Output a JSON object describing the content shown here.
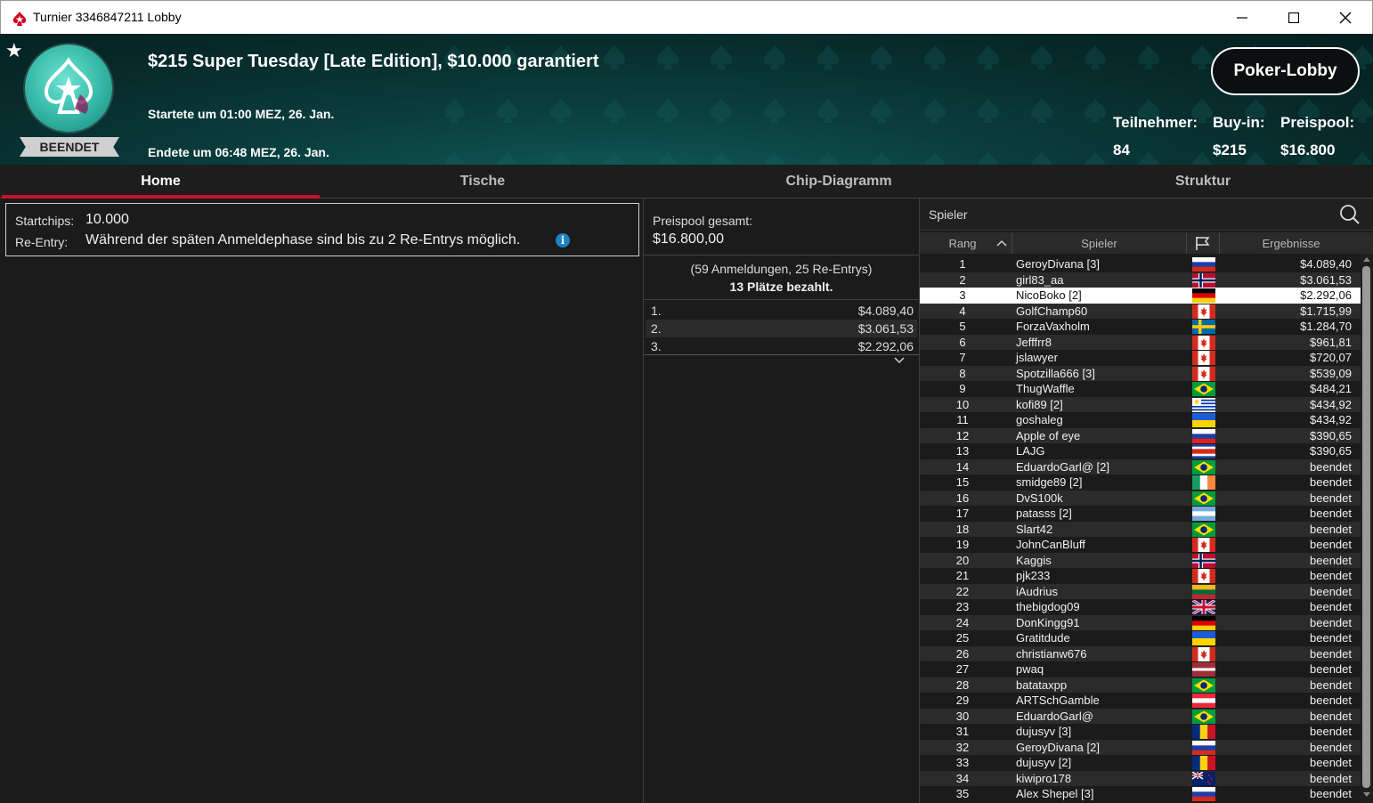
{
  "window": {
    "title": "Turnier 3346847211 Lobby"
  },
  "header": {
    "tournament_title": "$215 Super Tuesday [Late Edition], $10.000 garantiert",
    "status_badge": "BEENDET",
    "started": "Startete um 01:00 MEZ, 26. Jan.",
    "ended": "Endete um 06:48 MEZ, 26. Jan.",
    "lobby_button": "Poker-Lobby",
    "stats": {
      "participants_label": "Teilnehmer:",
      "participants": "84",
      "buyin_label": "Buy-in:",
      "buyin": "$215",
      "prizepool_label": "Preispool:",
      "prizepool": "$16.800"
    }
  },
  "tabs": [
    {
      "label": "Home",
      "active": true
    },
    {
      "label": "Tische",
      "active": false
    },
    {
      "label": "Chip-Diagramm",
      "active": false
    },
    {
      "label": "Struktur",
      "active": false
    }
  ],
  "info": {
    "startchips_label": "Startchips:",
    "startchips": "10.000",
    "reentry_label": "Re-Entry:",
    "reentry": "Während der späten Anmeldephase sind bis zu 2 Re-Entrys möglich."
  },
  "prize": {
    "total_label": "Preispool gesamt:",
    "total": "$16.800,00",
    "entries": "(59 Anmeldungen, 25 Re-Entrys)",
    "paid": "13 Plätze bezahlt.",
    "payouts": [
      {
        "rank": "1.",
        "amount": "$4.089,40"
      },
      {
        "rank": "2.",
        "amount": "$3.061,53"
      },
      {
        "rank": "3.",
        "amount": "$2.292,06"
      }
    ]
  },
  "players": {
    "search_placeholder": "Spieler",
    "col_rank": "Rang",
    "col_player": "Spieler",
    "col_result": "Ergebnisse",
    "highlight_rank": "3",
    "rows": [
      {
        "rank": "1",
        "name": "GeroyDivana [3]",
        "flag": "ru",
        "result": "$4.089,40"
      },
      {
        "rank": "2",
        "name": "girl83_aa",
        "flag": "no",
        "result": "$3.061,53"
      },
      {
        "rank": "3",
        "name": "NicoBoko [2]",
        "flag": "de",
        "result": "$2.292,06"
      },
      {
        "rank": "4",
        "name": "GolfChamp60",
        "flag": "ca",
        "result": "$1.715,99"
      },
      {
        "rank": "5",
        "name": "ForzaVaxholm",
        "flag": "se",
        "result": "$1.284,70"
      },
      {
        "rank": "6",
        "name": "Jefffrr8",
        "flag": "ca",
        "result": "$961,81"
      },
      {
        "rank": "7",
        "name": "jslawyer",
        "flag": "ca",
        "result": "$720,07"
      },
      {
        "rank": "8",
        "name": "Spotzilla666 [3]",
        "flag": "ca",
        "result": "$539,09"
      },
      {
        "rank": "9",
        "name": "ThugWaffle",
        "flag": "br",
        "result": "$484,21"
      },
      {
        "rank": "10",
        "name": "kofi89 [2]",
        "flag": "uy",
        "result": "$434,92"
      },
      {
        "rank": "11",
        "name": "goshaleg",
        "flag": "ua",
        "result": "$434,92"
      },
      {
        "rank": "12",
        "name": "Apple of eye",
        "flag": "si",
        "result": "$390,65"
      },
      {
        "rank": "13",
        "name": "LAJG",
        "flag": "cr",
        "result": "$390,65"
      },
      {
        "rank": "14",
        "name": "EduardoGarl@ [2]",
        "flag": "br",
        "result": "beendet"
      },
      {
        "rank": "15",
        "name": "smidge89 [2]",
        "flag": "ie",
        "result": "beendet"
      },
      {
        "rank": "16",
        "name": "DvS100k",
        "flag": "br",
        "result": "beendet"
      },
      {
        "rank": "17",
        "name": "patasss [2]",
        "flag": "ar",
        "result": "beendet"
      },
      {
        "rank": "18",
        "name": "Slart42",
        "flag": "br",
        "result": "beendet"
      },
      {
        "rank": "19",
        "name": "JohnCanBluff",
        "flag": "ca",
        "result": "beendet"
      },
      {
        "rank": "20",
        "name": "Kaggis",
        "flag": "no",
        "result": "beendet"
      },
      {
        "rank": "21",
        "name": "pjk233",
        "flag": "ca",
        "result": "beendet"
      },
      {
        "rank": "22",
        "name": "iAudrius",
        "flag": "lt",
        "result": "beendet"
      },
      {
        "rank": "23",
        "name": "thebigdog09",
        "flag": "gb",
        "result": "beendet"
      },
      {
        "rank": "24",
        "name": "DonKingg91",
        "flag": "de",
        "result": "beendet"
      },
      {
        "rank": "25",
        "name": "Gratitdude",
        "flag": "ua",
        "result": "beendet"
      },
      {
        "rank": "26",
        "name": "christianw676",
        "flag": "ca",
        "result": "beendet"
      },
      {
        "rank": "27",
        "name": "pwaq",
        "flag": "lv",
        "result": "beendet"
      },
      {
        "rank": "28",
        "name": "batataxpp",
        "flag": "br",
        "result": "beendet"
      },
      {
        "rank": "29",
        "name": "ARTSchGamble",
        "flag": "at",
        "result": "beendet"
      },
      {
        "rank": "30",
        "name": "EduardoGarl@",
        "flag": "br",
        "result": "beendet"
      },
      {
        "rank": "31",
        "name": "dujusyv [3]",
        "flag": "ro",
        "result": "beendet"
      },
      {
        "rank": "32",
        "name": "GeroyDivana [2]",
        "flag": "ru",
        "result": "beendet"
      },
      {
        "rank": "33",
        "name": "dujusyv [2]",
        "flag": "ro",
        "result": "beendet"
      },
      {
        "rank": "34",
        "name": "kiwipro178",
        "flag": "nz",
        "result": "beendet"
      },
      {
        "rank": "35",
        "name": "Alex Shepel [3]",
        "flag": "ru",
        "result": "beendet"
      }
    ]
  },
  "colors": {
    "accent": "#c8102e",
    "header_bg": "#0a3c3c",
    "info_icon": "#1b82c4"
  }
}
